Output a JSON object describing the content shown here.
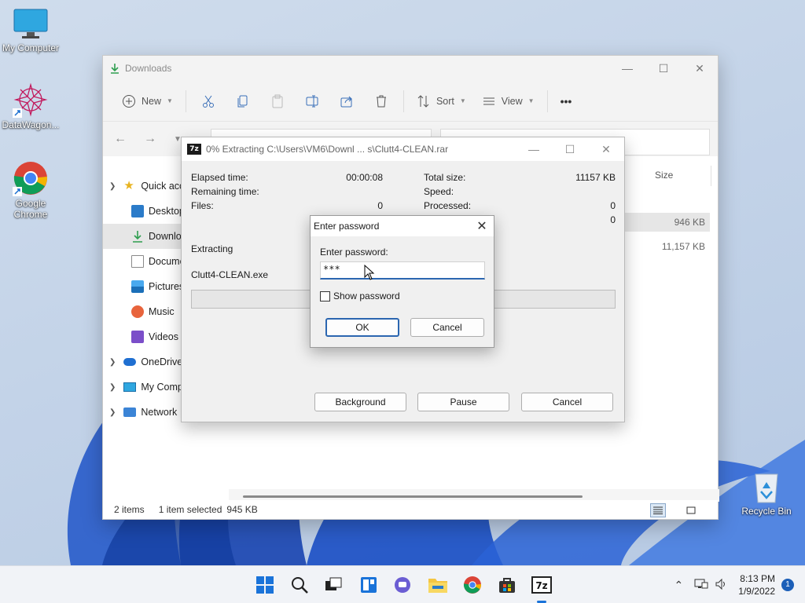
{
  "desktop": {
    "icons": [
      {
        "label": "My Computer",
        "icon": "monitor-icon"
      },
      {
        "label": "DataWagon...",
        "icon": "datawagon-icon"
      },
      {
        "label": "Google Chrome",
        "icon": "chrome-icon"
      },
      {
        "label": "Recycle Bin",
        "icon": "recycle-bin-icon"
      }
    ]
  },
  "explorer": {
    "title": "Downloads",
    "toolbar": {
      "new_label": "New",
      "sort_label": "Sort",
      "view_label": "View",
      "more_label": "•••"
    },
    "sidebar": [
      {
        "label": "Quick access",
        "icon": "star-icon"
      },
      {
        "label": "Desktop",
        "icon": "desktop-folder-icon"
      },
      {
        "label": "Downloads",
        "icon": "download-icon"
      },
      {
        "label": "Documents",
        "icon": "documents-icon"
      },
      {
        "label": "Pictures",
        "icon": "pictures-icon"
      },
      {
        "label": "Music",
        "icon": "music-icon"
      },
      {
        "label": "Videos",
        "icon": "videos-icon"
      },
      {
        "label": "OneDrive",
        "icon": "onedrive-icon"
      },
      {
        "label": "My Computer",
        "icon": "computer-icon"
      },
      {
        "label": "Network",
        "icon": "network-icon"
      }
    ],
    "columns": {
      "size": "Size"
    },
    "rows": [
      {
        "size": "946 KB"
      },
      {
        "size": "11,157 KB"
      }
    ],
    "status": {
      "items": "2 items",
      "selected": "1 item selected",
      "selected_size": "945 KB"
    }
  },
  "zip": {
    "title": "0% Extracting C:\\Users\\VM6\\Downl ... s\\Clutt4-CLEAN.rar",
    "left": [
      {
        "k": "Elapsed time:",
        "v": "00:00:08"
      },
      {
        "k": "Remaining time:",
        "v": ""
      },
      {
        "k": "Files:",
        "v": "0"
      }
    ],
    "right": [
      {
        "k": "Total size:",
        "v": "11157 KB"
      },
      {
        "k": "Speed:",
        "v": ""
      },
      {
        "k": "Processed:",
        "v": "0"
      },
      {
        "k": "",
        "v": "0"
      }
    ],
    "status_label": "Extracting",
    "current_file": "Clutt4-CLEAN.exe",
    "progress": 0,
    "buttons": {
      "background": "Background",
      "pause": "Pause",
      "cancel": "Cancel"
    }
  },
  "password_dialog": {
    "title": "Enter password",
    "label": "Enter password:",
    "value": "***",
    "show_password": "Show password",
    "ok": "OK",
    "cancel": "Cancel"
  },
  "taskbar": {
    "time": "8:13 PM",
    "date": "1/9/2022",
    "notifications": "1",
    "apps": [
      "start-icon",
      "search-icon",
      "task-view-icon",
      "widgets-icon",
      "teams-chat-icon",
      "file-explorer-icon",
      "chrome-icon",
      "store-icon",
      "7zip-icon"
    ]
  }
}
